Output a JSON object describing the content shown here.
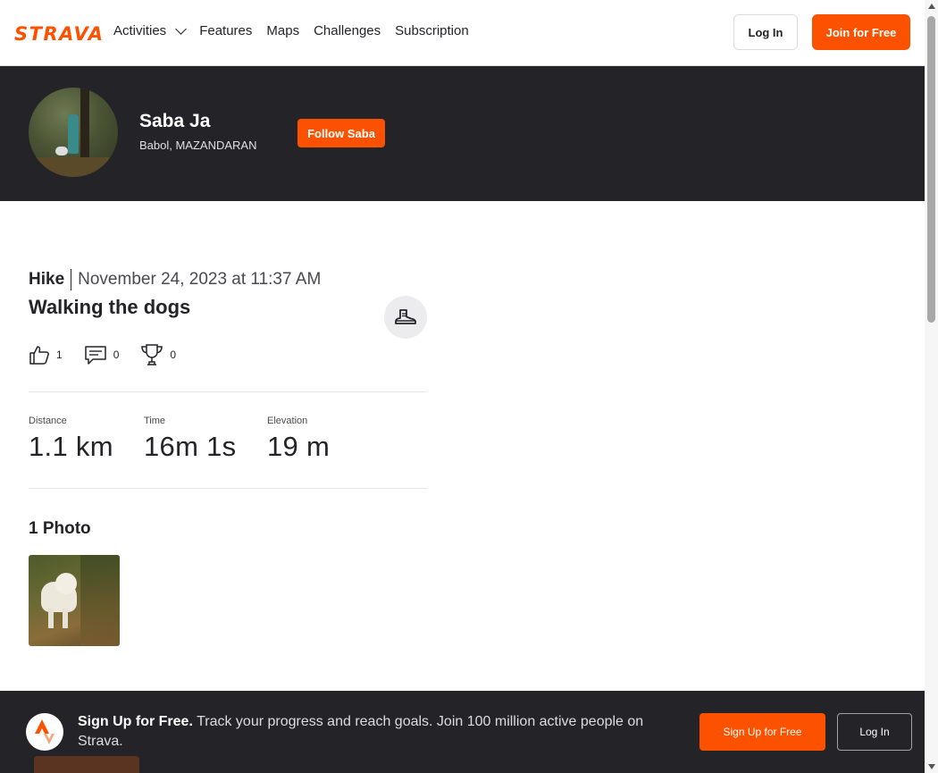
{
  "nav": {
    "logo": "STRAVA",
    "links": [
      "Activities",
      "Features",
      "Maps",
      "Challenges",
      "Subscription"
    ],
    "login_label": "Log In",
    "join_label": "Join for Free"
  },
  "athlete": {
    "name": "Saba Ja",
    "location": "Babol, MAZANDARAN",
    "follow_label": "Follow Saba"
  },
  "activity": {
    "type": "Hike",
    "date": "November 24, 2023 at 11:37 AM",
    "title": "Walking the dogs",
    "sport_icon": "hiking-boot-icon",
    "kudos_count": "1",
    "comments_count": "0",
    "achievements_count": "0",
    "stats": [
      {
        "label": "Distance",
        "value": "1.1 km"
      },
      {
        "label": "Time",
        "value": "16m 1s"
      },
      {
        "label": "Elevation",
        "value": "19 m"
      }
    ],
    "photos_heading": "1 Photo"
  },
  "banner": {
    "headline": "Sign Up for Free.",
    "body": "Track your progress and reach goals. Join 100 million active people on Strava.",
    "signup_label": "Sign Up for Free",
    "login_label": "Log In"
  },
  "colors": {
    "brand": "#fc5200",
    "dark": "#242428"
  }
}
